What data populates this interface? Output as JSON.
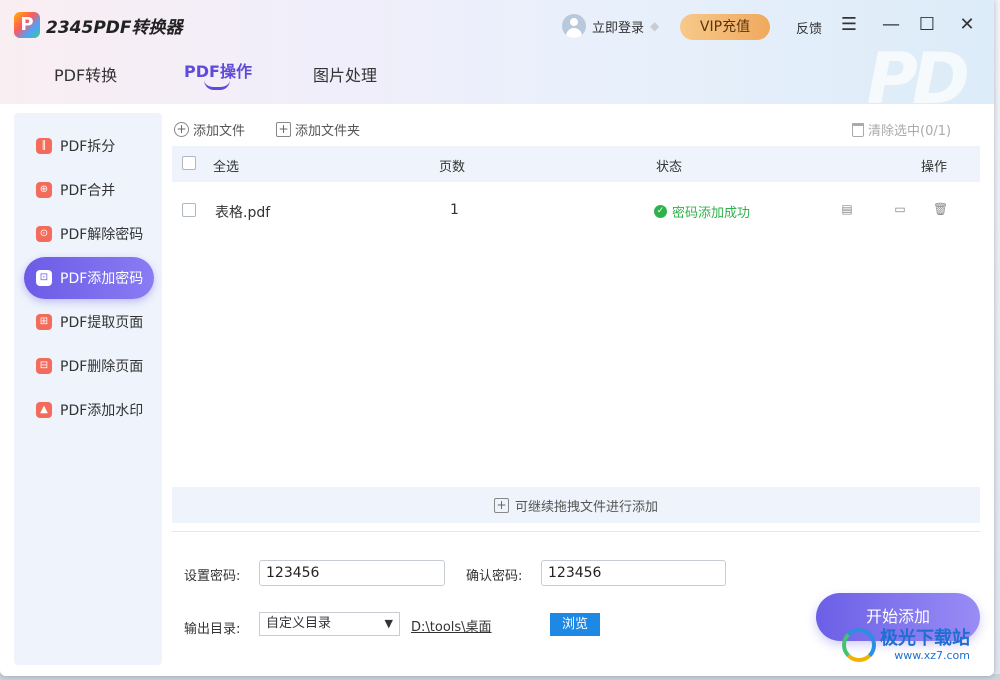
{
  "app": {
    "title": "2345PDF转换器",
    "logo_letter": "P",
    "watermark": "PD"
  },
  "header": {
    "login_label": "立即登录",
    "vip_label": "VIP充值",
    "feedback_label": "反馈",
    "menu_glyph": "☰",
    "minimize_glyph": "—",
    "maximize_glyph": "☐",
    "close_glyph": "✕"
  },
  "tabs": [
    {
      "label": "PDF转换"
    },
    {
      "label": "PDF操作"
    },
    {
      "label": "图片处理"
    }
  ],
  "sidebar": {
    "items": [
      {
        "label": "PDF拆分",
        "icon": "split-icon"
      },
      {
        "label": "PDF合并",
        "icon": "merge-icon"
      },
      {
        "label": "PDF解除密码",
        "icon": "unlock-icon"
      },
      {
        "label": "PDF添加密码",
        "icon": "lock-icon"
      },
      {
        "label": "PDF提取页面",
        "icon": "extract-icon"
      },
      {
        "label": "PDF删除页面",
        "icon": "delete-page-icon"
      },
      {
        "label": "PDF添加水印",
        "icon": "watermark-icon"
      }
    ],
    "active_index": 3
  },
  "toolbar": {
    "add_file": "添加文件",
    "add_folder": "添加文件夹",
    "clear_selected": "清除选中(0/1)"
  },
  "table": {
    "headers": {
      "select_all": "全选",
      "pages": "页数",
      "status": "状态",
      "actions": "操作"
    },
    "rows": [
      {
        "name": "表格.pdf",
        "pages": "1",
        "status": "密码添加成功"
      }
    ]
  },
  "drop_hint": "可继续拖拽文件进行添加",
  "settings": {
    "password_label": "设置密码:",
    "password_value": "123456",
    "confirm_label": "确认密码:",
    "confirm_value": "123456",
    "output_label": "输出目录:",
    "output_option": "自定义目录",
    "output_path": "D:\\tools\\桌面",
    "browse_label": "浏览",
    "start_label": "开始添加"
  },
  "site_watermark": {
    "name": "极光下载站",
    "url": "www.xz7.com"
  },
  "colors": {
    "accent": "#5e4bd8",
    "success": "#2fb24a",
    "browse": "#1e88e5"
  }
}
